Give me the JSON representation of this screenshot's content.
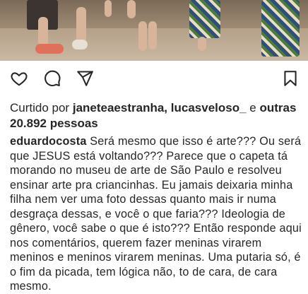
{
  "post": {
    "likes": {
      "prefix": "Curtido por",
      "user1": "janeteaestranha",
      "sep": ",",
      "user2": "lucasveloso_",
      "and": "e",
      "others_word": "outras",
      "count": "20.892 pessoas"
    },
    "caption": {
      "username": "eduardocosta",
      "text": "Será mesmo que isso é arte??? Ou será que JESUS está voltando??? Parece que o capeta tá morando no museu  de arte de São Paulo e resolveu ensinar arte pra criancinhas. Eu jamais deixaria minha filha nem ver uma foto dessas quanto mais ir numa desgraça dessas, e você o que faria??? Ideologia de gênero, você sabe o que é isto??? Então responde aqui nos comentários, querem fazer meninas virarem meninos e meninos virarem meninas. Uma putaria só, é o fim da picada, tem lógica não, to de cara, de cara mesmo."
    },
    "icons": {
      "like": "heart-icon",
      "comment": "comment-icon",
      "share": "share-icon",
      "save": "bookmark-icon"
    }
  }
}
